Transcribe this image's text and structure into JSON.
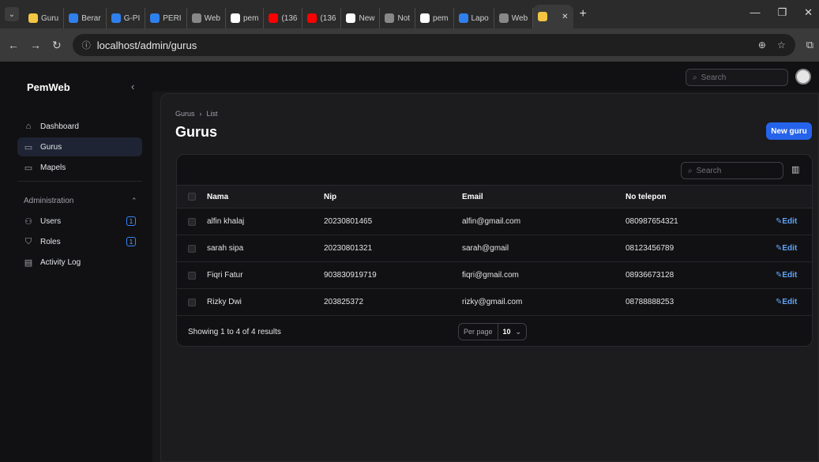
{
  "browser": {
    "tabs": [
      {
        "label": "Guru",
        "color": "#f4c542"
      },
      {
        "label": "Berar",
        "color": "#2f80ed"
      },
      {
        "label": "G-PI",
        "color": "#2f80ed"
      },
      {
        "label": "PERI",
        "color": "#2f80ed"
      },
      {
        "label": "Web",
        "color": "#888888"
      },
      {
        "label": "pem",
        "color": "#ffffff"
      },
      {
        "label": "(136",
        "color": "#ff0000"
      },
      {
        "label": "(136",
        "color": "#ff0000"
      },
      {
        "label": "New",
        "color": "#ffffff"
      },
      {
        "label": "Not",
        "color": "#888888"
      },
      {
        "label": "pem",
        "color": "#ffffff"
      },
      {
        "label": "Lapo",
        "color": "#2f80ed"
      },
      {
        "label": "Web",
        "color": "#888888"
      }
    ],
    "url": "localhost/admin/gurus"
  },
  "app": {
    "brand": "PemWeb",
    "search_placeholder": "Search"
  },
  "sidebar": {
    "items": [
      {
        "label": "Dashboard",
        "icon": "home-icon"
      },
      {
        "label": "Gurus",
        "icon": "folder-icon"
      },
      {
        "label": "Mapels",
        "icon": "folder-icon"
      }
    ],
    "group_label": "Administration",
    "admin_items": [
      {
        "label": "Users",
        "icon": "users-icon",
        "badge": "1"
      },
      {
        "label": "Roles",
        "icon": "shield-icon",
        "badge": "1"
      },
      {
        "label": "Activity Log",
        "icon": "log-icon"
      }
    ]
  },
  "page": {
    "breadcrumb_root": "Gurus",
    "breadcrumb_current": "List",
    "title": "Gurus",
    "new_button": "New guru"
  },
  "table": {
    "search_placeholder": "Search",
    "columns": [
      "Nama",
      "Nip",
      "Email",
      "No telepon"
    ],
    "rows": [
      {
        "nama": "alfin khalaj",
        "nip": "20230801465",
        "email": "alfin@gmail.com",
        "telepon": "080987654321"
      },
      {
        "nama": "sarah sipa",
        "nip": "20230801321",
        "email": "sarah@gmail",
        "telepon": "08123456789"
      },
      {
        "nama": "Fiqri Fatur",
        "nip": "903830919719",
        "email": "fiqri@gmail.com",
        "telepon": "08936673128"
      },
      {
        "nama": "Rizky Dwi",
        "nip": "203825372",
        "email": "rizky@gmail.com",
        "telepon": "08788888253"
      }
    ],
    "edit_label": "Edit",
    "showing": "Showing 1 to 4 of 4 results",
    "per_page_label": "Per page",
    "per_page_value": "10"
  }
}
